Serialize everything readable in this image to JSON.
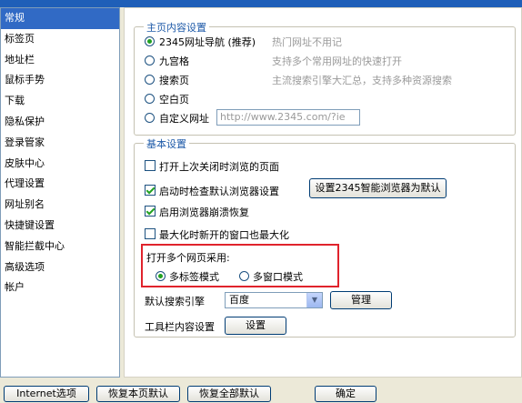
{
  "sidebar": {
    "items": [
      {
        "label": "常规",
        "selected": true
      },
      {
        "label": "标签页"
      },
      {
        "label": "地址栏"
      },
      {
        "label": "鼠标手势"
      },
      {
        "label": "下载"
      },
      {
        "label": "隐私保护"
      },
      {
        "label": "登录管家"
      },
      {
        "label": "皮肤中心"
      },
      {
        "label": "代理设置"
      },
      {
        "label": "网址别名"
      },
      {
        "label": "快捷键设置"
      },
      {
        "label": "智能拦截中心"
      },
      {
        "label": "高级选项"
      },
      {
        "label": "帐户"
      }
    ]
  },
  "homepage": {
    "legend": "主页内容设置",
    "options": [
      {
        "label": "2345网址导航 (推荐)",
        "desc": "热门网址不用记",
        "selected": true
      },
      {
        "label": "九宫格",
        "desc": "支持多个常用网址的快速打开"
      },
      {
        "label": "搜索页",
        "desc": "主流搜索引擎大汇总，支持多种资源搜索"
      },
      {
        "label": "空白页",
        "desc": ""
      },
      {
        "label": "自定义网址",
        "desc": ""
      }
    ],
    "custom_url": "http://www.2345.com/?ie"
  },
  "basic": {
    "legend": "基本设置",
    "checks": [
      {
        "label": "打开上次关闭时浏览的页面",
        "checked": false
      },
      {
        "label": "启动时检查默认浏览器设置",
        "checked": true
      },
      {
        "label": "启用浏览器崩溃恢复",
        "checked": true
      },
      {
        "label": "最大化时新开的窗口也最大化",
        "checked": false
      }
    ],
    "set_default_button": "设置2345智能浏览器为默认",
    "multi_page_label": "打开多个网页采用:",
    "mode_tabs": "多标签模式",
    "mode_windows": "多窗口模式",
    "search_engine_label": "默认搜索引擎",
    "search_engine_value": "百度",
    "manage_button": "管理",
    "toolbar_label": "工具栏内容设置",
    "toolbar_button": "设置"
  },
  "bottom": {
    "internet_options": "Internet选项",
    "restore_page": "恢复本页默认",
    "restore_all": "恢复全部默认",
    "ok": "确定"
  },
  "colors": {
    "selection": "#316ac5",
    "legend": "#1e5aa8",
    "highlight": "#e0232c",
    "check_mark": "#21a121"
  }
}
